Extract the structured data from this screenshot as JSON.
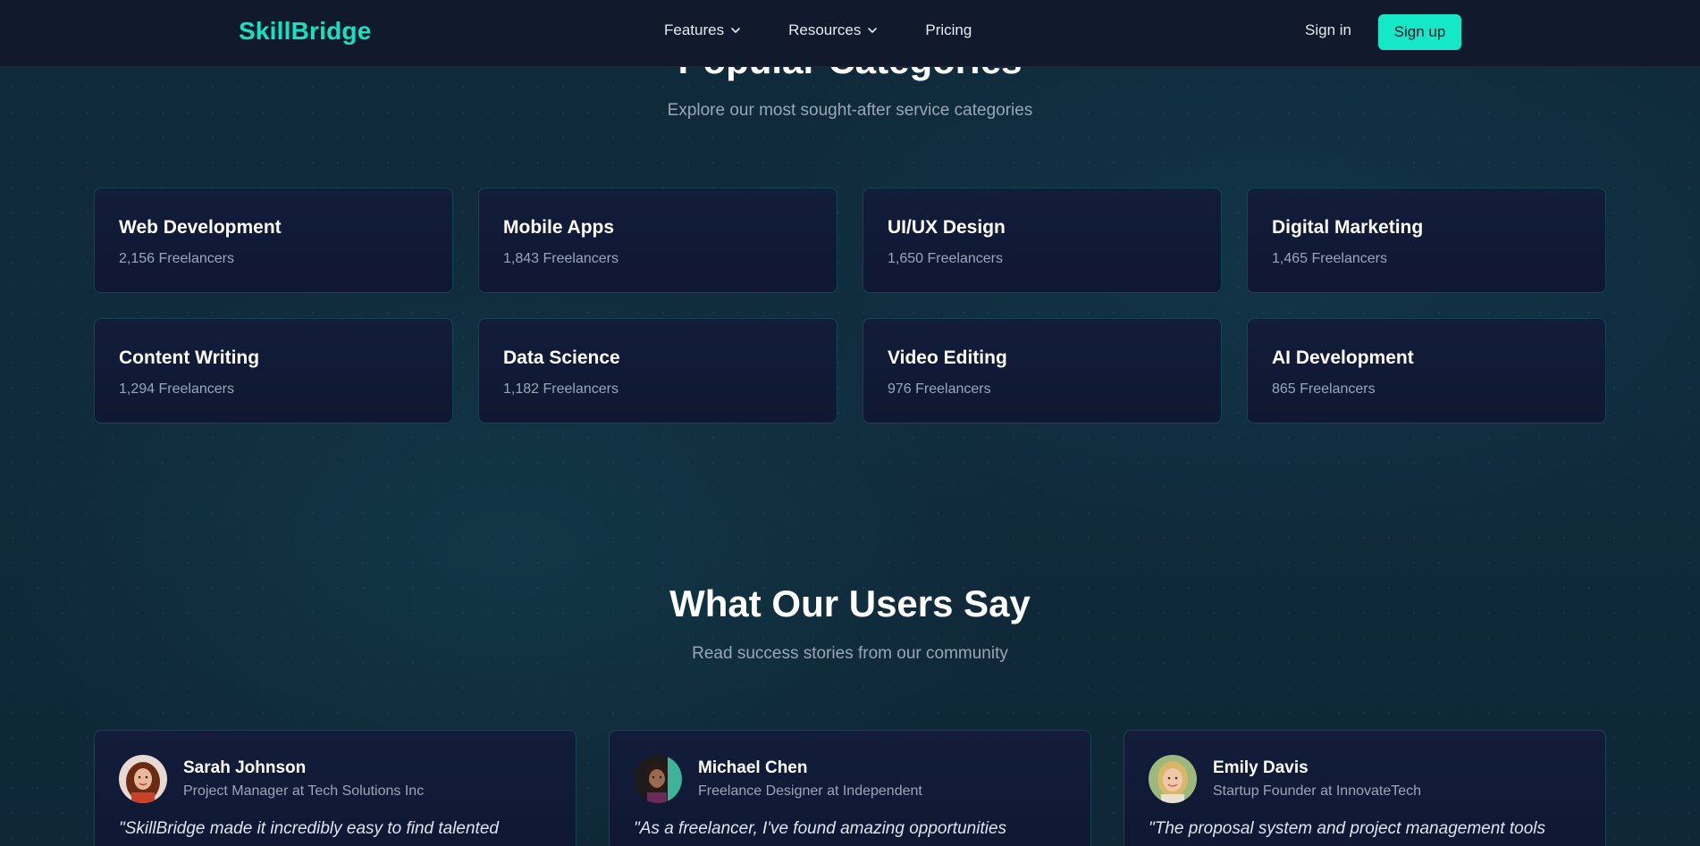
{
  "header": {
    "logo": "SkillBridge",
    "nav": [
      {
        "label": "Features",
        "has_dropdown": true
      },
      {
        "label": "Resources",
        "has_dropdown": true
      },
      {
        "label": "Pricing",
        "has_dropdown": false
      }
    ],
    "signin_label": "Sign in",
    "signup_label": "Sign up"
  },
  "categories": {
    "title": "Popular Categories",
    "subtitle": "Explore our most sought-after service categories",
    "items": [
      {
        "name": "Web Development",
        "count": "2,156 Freelancers"
      },
      {
        "name": "Mobile Apps",
        "count": "1,843 Freelancers"
      },
      {
        "name": "UI/UX Design",
        "count": "1,650 Freelancers"
      },
      {
        "name": "Digital Marketing",
        "count": "1,465 Freelancers"
      },
      {
        "name": "Content Writing",
        "count": "1,294 Freelancers"
      },
      {
        "name": "Data Science",
        "count": "1,182 Freelancers"
      },
      {
        "name": "Video Editing",
        "count": "976 Freelancers"
      },
      {
        "name": "AI Development",
        "count": "865 Freelancers"
      }
    ]
  },
  "testimonials": {
    "title": "What Our Users Say",
    "subtitle": "Read success stories from our community",
    "items": [
      {
        "name": "Sarah Johnson",
        "role": "Project Manager at Tech Solutions Inc",
        "quote": "\"SkillBridge made it incredibly easy to find talented",
        "avatar": "avatar-sarah"
      },
      {
        "name": "Michael Chen",
        "role": "Freelance Designer at Independent",
        "quote": "\"As a freelancer, I've found amazing opportunities",
        "avatar": "avatar-michael"
      },
      {
        "name": "Emily Davis",
        "role": "Startup Founder at InnovateTech",
        "quote": "\"The proposal system and project management tools",
        "avatar": "avatar-emily"
      }
    ]
  },
  "colors": {
    "accent": "#14e8c6",
    "nav_bg": "#111a2c",
    "card_bg": "#121d3a",
    "muted_text": "#9aa6b8"
  }
}
